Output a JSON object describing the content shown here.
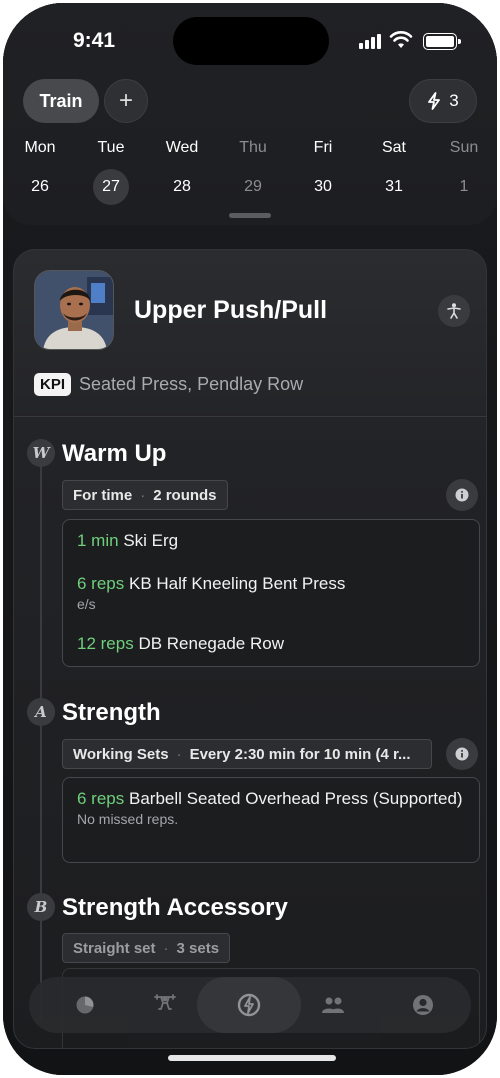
{
  "status_bar": {
    "time": "9:41"
  },
  "header": {
    "train_label": "Train",
    "add_label": "+",
    "streak_count": "3"
  },
  "week": {
    "days": [
      {
        "name": "Mon",
        "date": "26"
      },
      {
        "name": "Tue",
        "date": "27"
      },
      {
        "name": "Wed",
        "date": "28"
      },
      {
        "name": "Thu",
        "date": "29"
      },
      {
        "name": "Fri",
        "date": "30"
      },
      {
        "name": "Sat",
        "date": "31"
      },
      {
        "name": "Sun",
        "date": "1"
      }
    ]
  },
  "workout": {
    "title": "Upper Push/Pull",
    "kpi_badge": "KPI",
    "kpi_text": "Seated Press, Pendlay Row"
  },
  "sections": [
    {
      "letter": "W",
      "title": "Warm Up",
      "tag1": "For time",
      "tag2": "2 rounds",
      "exercises": [
        {
          "amount": "1 min",
          "name": "Ski Erg",
          "note": ""
        },
        {
          "amount": "6 reps",
          "name": "KB Half Kneeling Bent Press",
          "note": "e/s"
        },
        {
          "amount": "12 reps",
          "name": "DB Renegade Row",
          "note": ""
        }
      ]
    },
    {
      "letter": "A",
      "title": "Strength",
      "tag1": "Working Sets",
      "tag2": "Every 2:30 min for 10 min (4 r...",
      "exercises": [
        {
          "amount": "6 reps",
          "name": "Barbell Seated Overhead Press (Supported)",
          "note": "No missed reps."
        }
      ]
    },
    {
      "letter": "B",
      "title": "Strength Accessory",
      "tag1": "Straight set",
      "tag2": "3 sets",
      "exercises": []
    }
  ],
  "icons": {
    "streak": "lightning-icon",
    "workout_type": "person-exercise-icon",
    "info": "info-icon",
    "tabs": [
      "activity-chart-icon",
      "weightlifting-icon",
      "bolt-logo-icon",
      "community-icon",
      "profile-icon"
    ]
  }
}
